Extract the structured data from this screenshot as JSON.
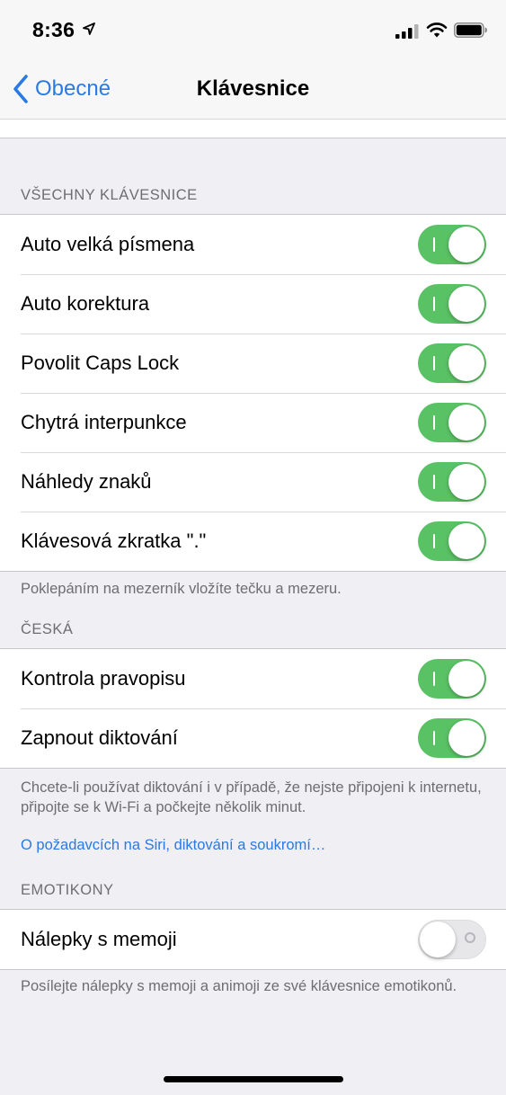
{
  "status_bar": {
    "time": "8:36"
  },
  "nav": {
    "back_label": "Obecné",
    "title": "Klávesnice"
  },
  "sections": {
    "all_keyboards": {
      "header": "VŠECHNY KLÁVESNICE",
      "rows": [
        {
          "label": "Auto velká písmena",
          "on": true
        },
        {
          "label": "Auto korektura",
          "on": true
        },
        {
          "label": "Povolit Caps Lock",
          "on": true
        },
        {
          "label": "Chytrá interpunkce",
          "on": true
        },
        {
          "label": "Náhledy znaků",
          "on": true
        },
        {
          "label": "Klávesová zkratka \".\"",
          "on": true
        }
      ],
      "footer": "Poklepáním na mezerník vložíte tečku a mezeru."
    },
    "czech": {
      "header": "ČESKÁ",
      "rows": [
        {
          "label": "Kontrola pravopisu",
          "on": true
        },
        {
          "label": "Zapnout diktování",
          "on": true
        }
      ],
      "footer": "Chcete-li používat diktování i v případě, že nejste připojeni k internetu, připojte se k Wi-Fi a počkejte několik minut.",
      "link": "O požadavcích na Siri, diktování a soukromí…"
    },
    "emoji": {
      "header": "EMOTIKONY",
      "rows": [
        {
          "label": "Nálepky s memoji",
          "on": false
        }
      ],
      "footer": "Posílejte nálepky s memoji a animoji ze své klávesnice emotikonů."
    }
  },
  "colors": {
    "accent": "#2a7ae4",
    "toggle_on": "#59c264",
    "background": "#efeff4"
  },
  "icons": [
    "location-arrow-icon",
    "cellular-signal-icon",
    "wifi-icon",
    "battery-icon",
    "chevron-left-icon"
  ]
}
